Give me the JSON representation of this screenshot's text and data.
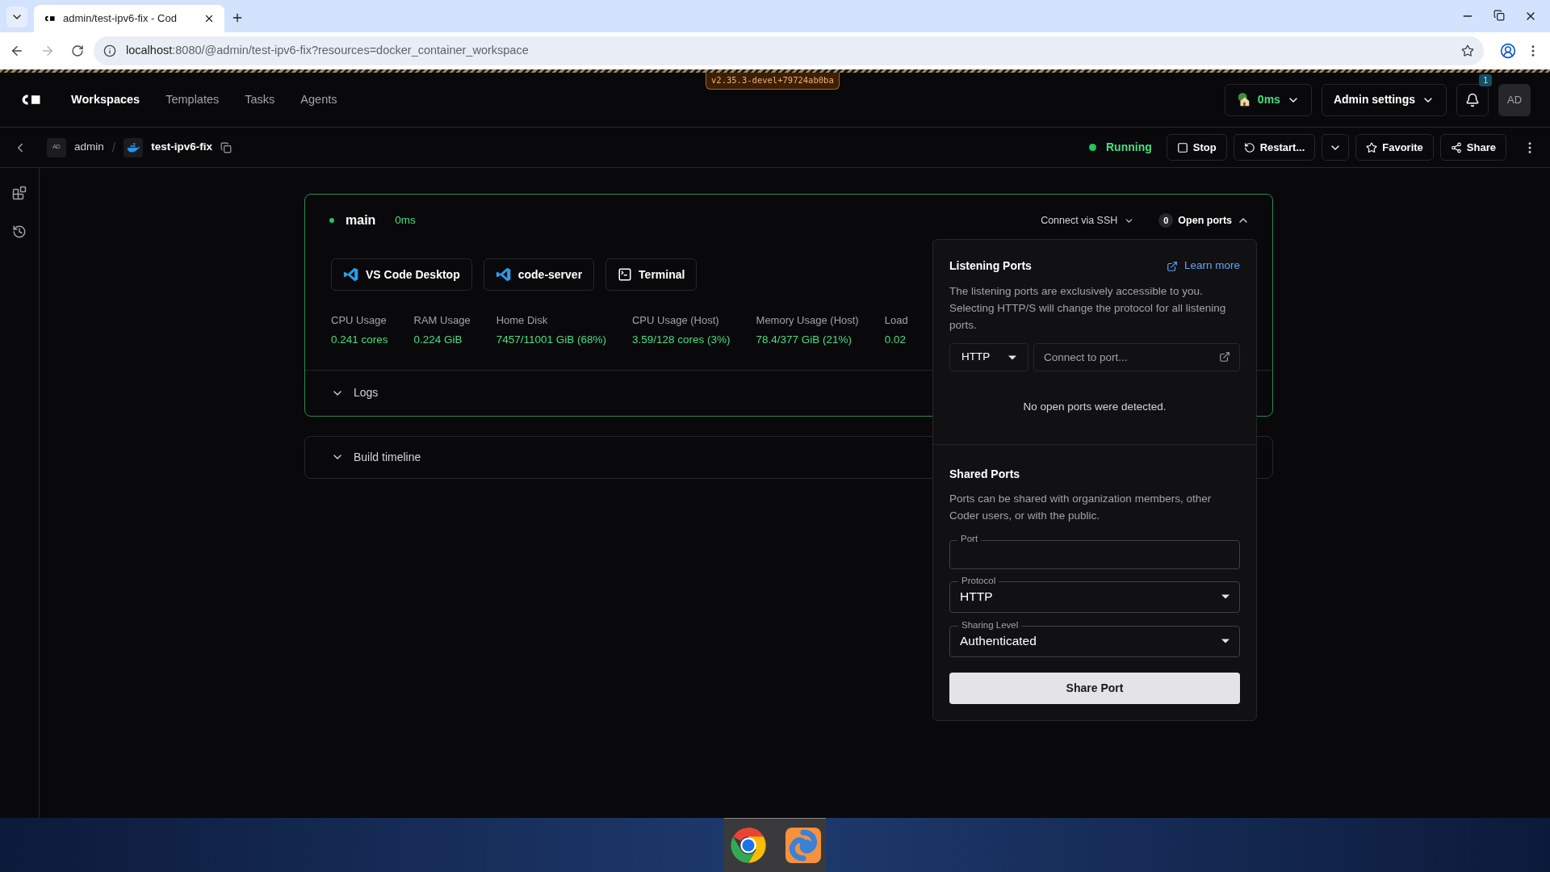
{
  "browser": {
    "tab_title": "admin/test-ipv6-fix - Cod",
    "url_host": "localhost",
    "url_rest": ":8080/@admin/test-ipv6-fix?resources=docker_container_workspace"
  },
  "version_badge": "v2.35.3-devel+79724ab0ba",
  "nav": {
    "items": [
      {
        "label": "Workspaces",
        "selected": true
      },
      {
        "label": "Templates",
        "selected": false
      },
      {
        "label": "Tasks",
        "selected": false
      },
      {
        "label": "Agents",
        "selected": false
      }
    ],
    "latency": "0ms",
    "admin_settings": "Admin settings",
    "notification_count": "1",
    "avatar": "AD"
  },
  "breadcrumb": {
    "owner_avatar": "AD",
    "owner": "admin",
    "separator": "/",
    "workspace": "test-ipv6-fix"
  },
  "status": "Running",
  "actions": [
    {
      "label": "Stop",
      "kind": "stop"
    },
    {
      "label": "Restart...",
      "kind": "restart"
    },
    {
      "label": "Favorite",
      "kind": "favorite"
    },
    {
      "label": "Share",
      "kind": "share"
    }
  ],
  "agent": {
    "name": "main",
    "latency": "0ms",
    "ssh": "Connect via SSH",
    "open_ports_count": "0",
    "open_ports_label": "Open ports",
    "open_ports_expanded": true,
    "apps": [
      {
        "label": "VS Code Desktop",
        "kind": "vscode"
      },
      {
        "label": "code-server",
        "kind": "vscode"
      },
      {
        "label": "Terminal",
        "kind": "terminal"
      }
    ],
    "metrics": [
      {
        "label": "CPU Usage",
        "value": "0.241 cores"
      },
      {
        "label": "RAM Usage",
        "value": "0.224 GiB"
      },
      {
        "label": "Home Disk",
        "value": "7457/11001 GiB (68%)"
      },
      {
        "label": "CPU Usage (Host)",
        "value": "3.59/128 cores (3%)"
      },
      {
        "label": "Memory Usage (Host)",
        "value": "78.4/377 GiB (21%)"
      },
      {
        "label": "Load",
        "value": "0.02"
      }
    ],
    "logs": {
      "label": "Logs",
      "expanded": false
    }
  },
  "build_timeline": {
    "label": "Build timeline",
    "expanded": false
  },
  "ports_popover": {
    "listening_title": "Listening Ports",
    "learn_more": "Learn more",
    "listening_description": "The listening ports are exclusively accessible to you. Selecting HTTP/S will change the protocol for all listening ports.",
    "protocol": "HTTP",
    "connect_placeholder": "Connect to port...",
    "empty": "No open ports were detected.",
    "shared_title": "Shared Ports",
    "shared_description": "Ports can be shared with organization members, other Coder users, or with the public.",
    "port_label": "Port",
    "protocol_label": "Protocol",
    "protocol_value": "HTTP",
    "sharing_label": "Sharing Level",
    "sharing_value": "Authenticated",
    "share_button": "Share Port"
  }
}
